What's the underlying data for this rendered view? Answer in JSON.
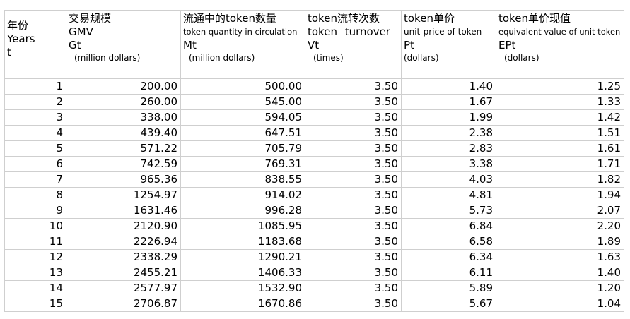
{
  "header": {
    "col0": [
      "年份",
      "Years",
      "t"
    ],
    "col1": {
      "zh": "交易规模",
      "en": "GMV",
      "sym": "Gt",
      "unit": "(million dollars)"
    },
    "col2": {
      "zh": "流通中的token数量",
      "en": "token quantity in circulation",
      "sym": "Mt",
      "unit": "(million dollars)"
    },
    "col3": {
      "zh": "token流转次数",
      "en": "token  turnover",
      "sym": "Vt",
      "unit": "(times)"
    },
    "col4": {
      "zh": "token单价",
      "en": "unit-price of token",
      "sym": "Pt",
      "unit": "(dollars)"
    },
    "col5": {
      "zh": "token单价现值",
      "en": "equivalent value of unit token",
      "sym": "EPt",
      "unit": "(dollars)"
    }
  },
  "rows": [
    [
      "1",
      "200.00",
      "500.00",
      "3.50",
      "1.40",
      "1.25"
    ],
    [
      "2",
      "260.00",
      "545.00",
      "3.50",
      "1.67",
      "1.33"
    ],
    [
      "3",
      "338.00",
      "594.05",
      "3.50",
      "1.99",
      "1.42"
    ],
    [
      "4",
      "439.40",
      "647.51",
      "3.50",
      "2.38",
      "1.51"
    ],
    [
      "5",
      "571.22",
      "705.79",
      "3.50",
      "2.83",
      "1.61"
    ],
    [
      "6",
      "742.59",
      "769.31",
      "3.50",
      "3.38",
      "1.71"
    ],
    [
      "7",
      "965.36",
      "838.55",
      "3.50",
      "4.03",
      "1.82"
    ],
    [
      "8",
      "1254.97",
      "914.02",
      "3.50",
      "4.81",
      "1.94"
    ],
    [
      "9",
      "1631.46",
      "996.28",
      "3.50",
      "5.73",
      "2.07"
    ],
    [
      "10",
      "2120.90",
      "1085.95",
      "3.50",
      "6.84",
      "2.20"
    ],
    [
      "11",
      "2226.94",
      "1183.68",
      "3.50",
      "6.58",
      "1.89"
    ],
    [
      "12",
      "2338.29",
      "1290.21",
      "3.50",
      "6.34",
      "1.63"
    ],
    [
      "13",
      "2455.21",
      "1406.33",
      "3.50",
      "6.11",
      "1.40"
    ],
    [
      "14",
      "2577.97",
      "1532.90",
      "3.50",
      "5.89",
      "1.20"
    ],
    [
      "15",
      "2706.87",
      "1670.86",
      "3.50",
      "5.67",
      "1.04"
    ]
  ]
}
